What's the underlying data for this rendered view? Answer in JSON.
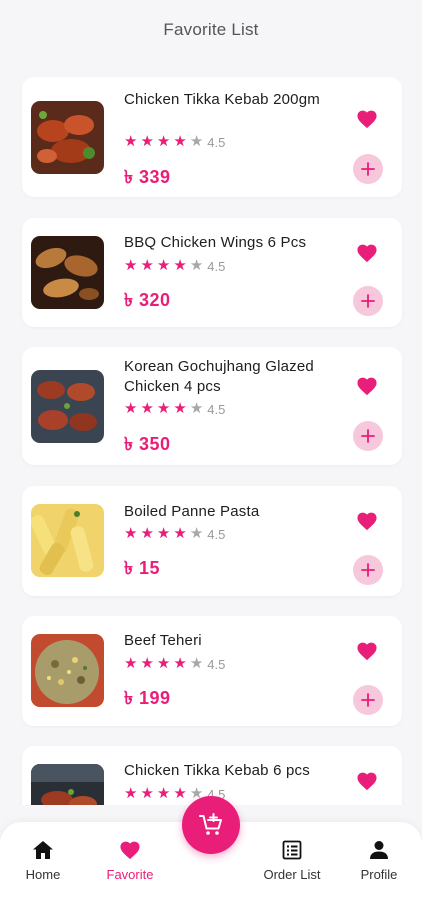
{
  "header": {
    "title": "Favorite List"
  },
  "currency_symbol": "৳",
  "items": [
    {
      "name": "Chicken Tikka Kebab 200gm",
      "rating": "4.5",
      "price": "৳ 339"
    },
    {
      "name": "BBQ Chicken Wings 6 Pcs",
      "rating": "4.5",
      "price": "৳ 320"
    },
    {
      "name": "Korean Gochujhang Glazed Chicken 4 pcs",
      "rating": "4.5",
      "price": "৳ 350"
    },
    {
      "name": "Boiled Panne Pasta",
      "rating": "4.5",
      "price": "৳ 15"
    },
    {
      "name": "Beef Teheri",
      "rating": "4.5",
      "price": "৳ 199"
    },
    {
      "name": "Chicken Tikka Kebab 6 pcs",
      "rating": "4.5",
      "price": ""
    }
  ],
  "stars": {
    "filled": 4,
    "total": 5
  },
  "nav": {
    "home": "Home",
    "favorite": "Favorite",
    "order_list": "Order List",
    "profile": "Profile",
    "active": "favorite"
  },
  "colors": {
    "accent": "#e91e78",
    "accent_light": "#f7c7dc",
    "background": "#f6f6f8",
    "card": "#ffffff"
  },
  "icons": {
    "heart": "heart-icon",
    "add": "plus-icon",
    "cart": "cart-plus-icon",
    "home": "home-icon",
    "order_list": "list-icon",
    "profile": "person-icon"
  }
}
